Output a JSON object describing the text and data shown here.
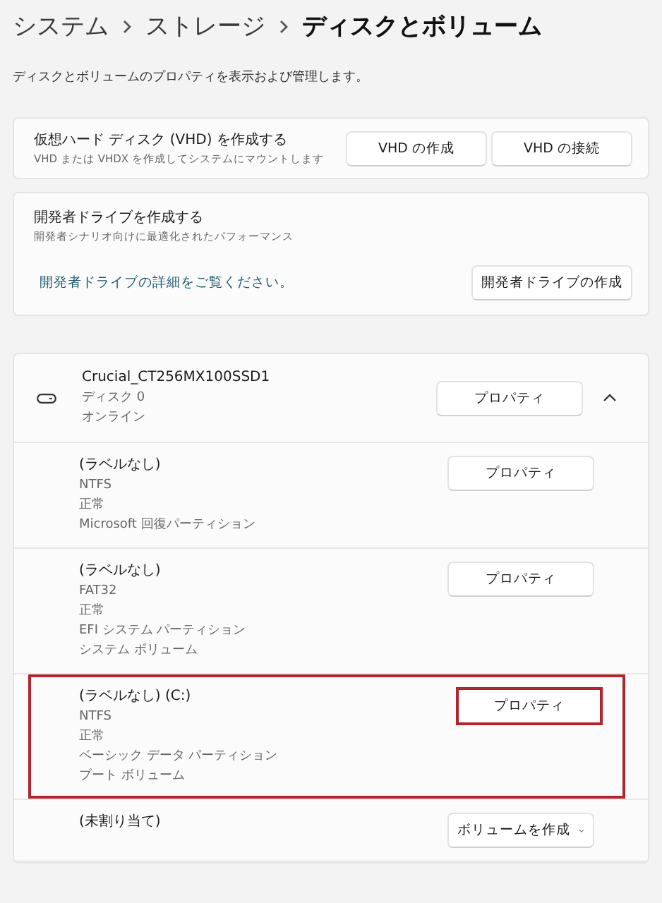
{
  "breadcrumb": [
    {
      "label": "システム",
      "current": false
    },
    {
      "label": "ストレージ",
      "current": false
    },
    {
      "label": "ディスクとボリューム",
      "current": true
    }
  ],
  "subtitle": "ディスクとボリュームのプロパティを表示および管理します。",
  "vhd_card": {
    "title": "仮想ハード ディスク (VHD) を作成する",
    "description": "VHD または VHDX を作成してシステムにマウントします",
    "buttons": [
      "VHD の作成",
      "VHD の接続"
    ]
  },
  "dev_drive_card": {
    "title": "開発者ドライブを作成する",
    "description": "開発者シナリオ向けに最適化されたパフォーマンス",
    "link": "開発者ドライブの詳細をご覧ください。",
    "button": "開発者ドライブの作成"
  },
  "disk": {
    "name": "Crucial_CT256MX100SSD1",
    "details": [
      "ディスク 0",
      "オンライン"
    ],
    "button": "プロパティ",
    "expanded": true,
    "volumes": [
      {
        "label": "(ラベルなし)",
        "details": [
          "NTFS",
          "正常",
          "Microsoft 回復パーティション"
        ],
        "action": {
          "kind": "button",
          "label": "プロパティ"
        },
        "highlighted": false
      },
      {
        "label": "(ラベルなし)",
        "details": [
          "FAT32",
          "正常",
          "EFI システム パーティション",
          "システム ボリューム"
        ],
        "action": {
          "kind": "button",
          "label": "プロパティ"
        },
        "highlighted": false
      },
      {
        "label": "(ラベルなし) (C:)",
        "details": [
          "NTFS",
          "正常",
          "ベーシック データ パーティション",
          "ブート ボリューム"
        ],
        "action": {
          "kind": "button",
          "label": "プロパティ"
        },
        "highlighted": true
      },
      {
        "label": "(未割り当て)",
        "action": {
          "kind": "dropdown",
          "label": "ボリュームを作成"
        },
        "highlighted": false
      }
    ]
  }
}
